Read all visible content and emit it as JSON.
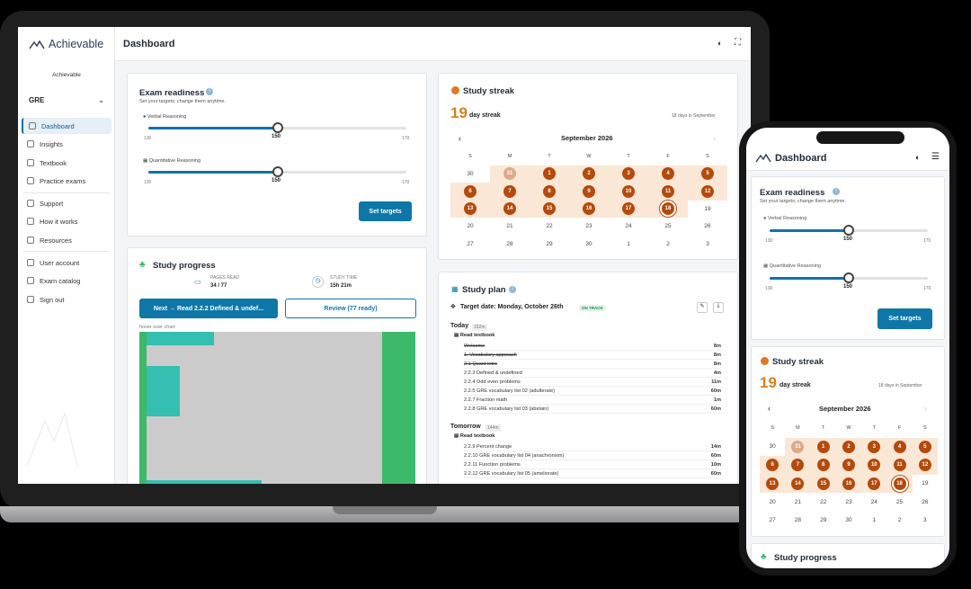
{
  "app": {
    "brand": "Achievable",
    "page_title": "Dashboard",
    "sidebar_org": "Achievable",
    "exam_select": "GRE"
  },
  "sidebar": {
    "items": [
      {
        "label": "Dashboard",
        "active": true
      },
      {
        "label": "Insights"
      },
      {
        "label": "Textbook"
      },
      {
        "label": "Practice exams"
      },
      {
        "label": "Support"
      },
      {
        "label": "How it works"
      },
      {
        "label": "Resources"
      },
      {
        "label": "User account"
      },
      {
        "label": "Exam catalog"
      },
      {
        "label": "Sign out"
      }
    ]
  },
  "readiness": {
    "title": "Exam readiness",
    "subtitle": "Set your targets; change them anytime.",
    "sliders": [
      {
        "label": "Verbal Reasoning",
        "min": "130",
        "max": "170",
        "value": "150",
        "fraction": 0.5
      },
      {
        "label": "Quantitative Reasoning",
        "min": "130",
        "max": "170",
        "value": "150",
        "fraction": 0.5
      }
    ],
    "button": "Set targets"
  },
  "streak": {
    "title": "Study streak",
    "count": "19",
    "count_label": "day streak",
    "month_days": "18 days in September",
    "month": "September 2026",
    "weekdays": [
      "S",
      "M",
      "T",
      "W",
      "T",
      "F",
      "S"
    ],
    "days": [
      {
        "d": "30",
        "s": "out"
      },
      {
        "d": "31",
        "s": "light"
      },
      {
        "d": "1",
        "s": "on"
      },
      {
        "d": "2",
        "s": "on"
      },
      {
        "d": "3",
        "s": "on"
      },
      {
        "d": "4",
        "s": "on"
      },
      {
        "d": "5",
        "s": "on"
      },
      {
        "d": "6",
        "s": "on"
      },
      {
        "d": "7",
        "s": "on"
      },
      {
        "d": "8",
        "s": "on"
      },
      {
        "d": "9",
        "s": "on"
      },
      {
        "d": "10",
        "s": "on"
      },
      {
        "d": "11",
        "s": "on"
      },
      {
        "d": "12",
        "s": "on"
      },
      {
        "d": "13",
        "s": "on"
      },
      {
        "d": "14",
        "s": "on"
      },
      {
        "d": "15",
        "s": "on"
      },
      {
        "d": "16",
        "s": "on"
      },
      {
        "d": "17",
        "s": "on"
      },
      {
        "d": "18",
        "s": "today"
      },
      {
        "d": "19",
        "s": "off"
      },
      {
        "d": "20",
        "s": "off"
      },
      {
        "d": "21",
        "s": "off"
      },
      {
        "d": "22",
        "s": "off"
      },
      {
        "d": "23",
        "s": "off"
      },
      {
        "d": "24",
        "s": "off"
      },
      {
        "d": "25",
        "s": "off"
      },
      {
        "d": "26",
        "s": "off"
      },
      {
        "d": "27",
        "s": "off"
      },
      {
        "d": "28",
        "s": "off"
      },
      {
        "d": "29",
        "s": "off"
      },
      {
        "d": "30",
        "s": "off"
      },
      {
        "d": "1",
        "s": "off"
      },
      {
        "d": "2",
        "s": "off"
      },
      {
        "d": "3",
        "s": "off"
      }
    ]
  },
  "progress": {
    "title": "Study progress",
    "pages_label": "PAGES READ",
    "pages_value": "34 / 77",
    "time_label": "STUDY TIME",
    "time_value": "15h 21m",
    "next_button": "Next → Read 2.2.2 Defined & undef...",
    "review_button": "Review (77 ready)",
    "chart_hint": "hover over chart"
  },
  "plan": {
    "title": "Study plan",
    "target": "Target date: Monday, October 26th",
    "status": "ON TRACK",
    "today_label": "Today",
    "today_minutes": "152m",
    "tomorrow_label": "Tomorrow",
    "tomorrow_minutes": "144m",
    "section": "Read textbook",
    "today_tasks": [
      {
        "t": "Welcome",
        "m": "8m",
        "done": true
      },
      {
        "t": "1. Vocabulary approach",
        "m": "8m",
        "done": true
      },
      {
        "t": "2.1 Quant intro",
        "m": "8m",
        "done": true
      },
      {
        "t": "2.2.2 Defined & undefined",
        "m": "4m"
      },
      {
        "t": "2.2.4 Odd even problems",
        "m": "11m"
      },
      {
        "t": "2.2.5 GRE vocabulary list 02 (adulterate)",
        "m": "60m"
      },
      {
        "t": "2.2.7 Fraction math",
        "m": "1m"
      },
      {
        "t": "2.2.8 GRE vocabulary list 03 (abstain)",
        "m": "60m"
      }
    ],
    "tomorrow_tasks": [
      {
        "t": "2.2.9 Percent change",
        "m": "14m"
      },
      {
        "t": "2.2.10 GRE vocabulary list 04 (anachronism)",
        "m": "60m"
      },
      {
        "t": "2.2.11 Function problems",
        "m": "10m"
      },
      {
        "t": "2.2.12 GRE vocabulary list 05 (ameliorate)",
        "m": "60m"
      }
    ]
  },
  "colors": {
    "accent": "#0e77a8",
    "streak": "#b44a0b",
    "green": "#3cb96a",
    "teal": "#34bfb0"
  }
}
